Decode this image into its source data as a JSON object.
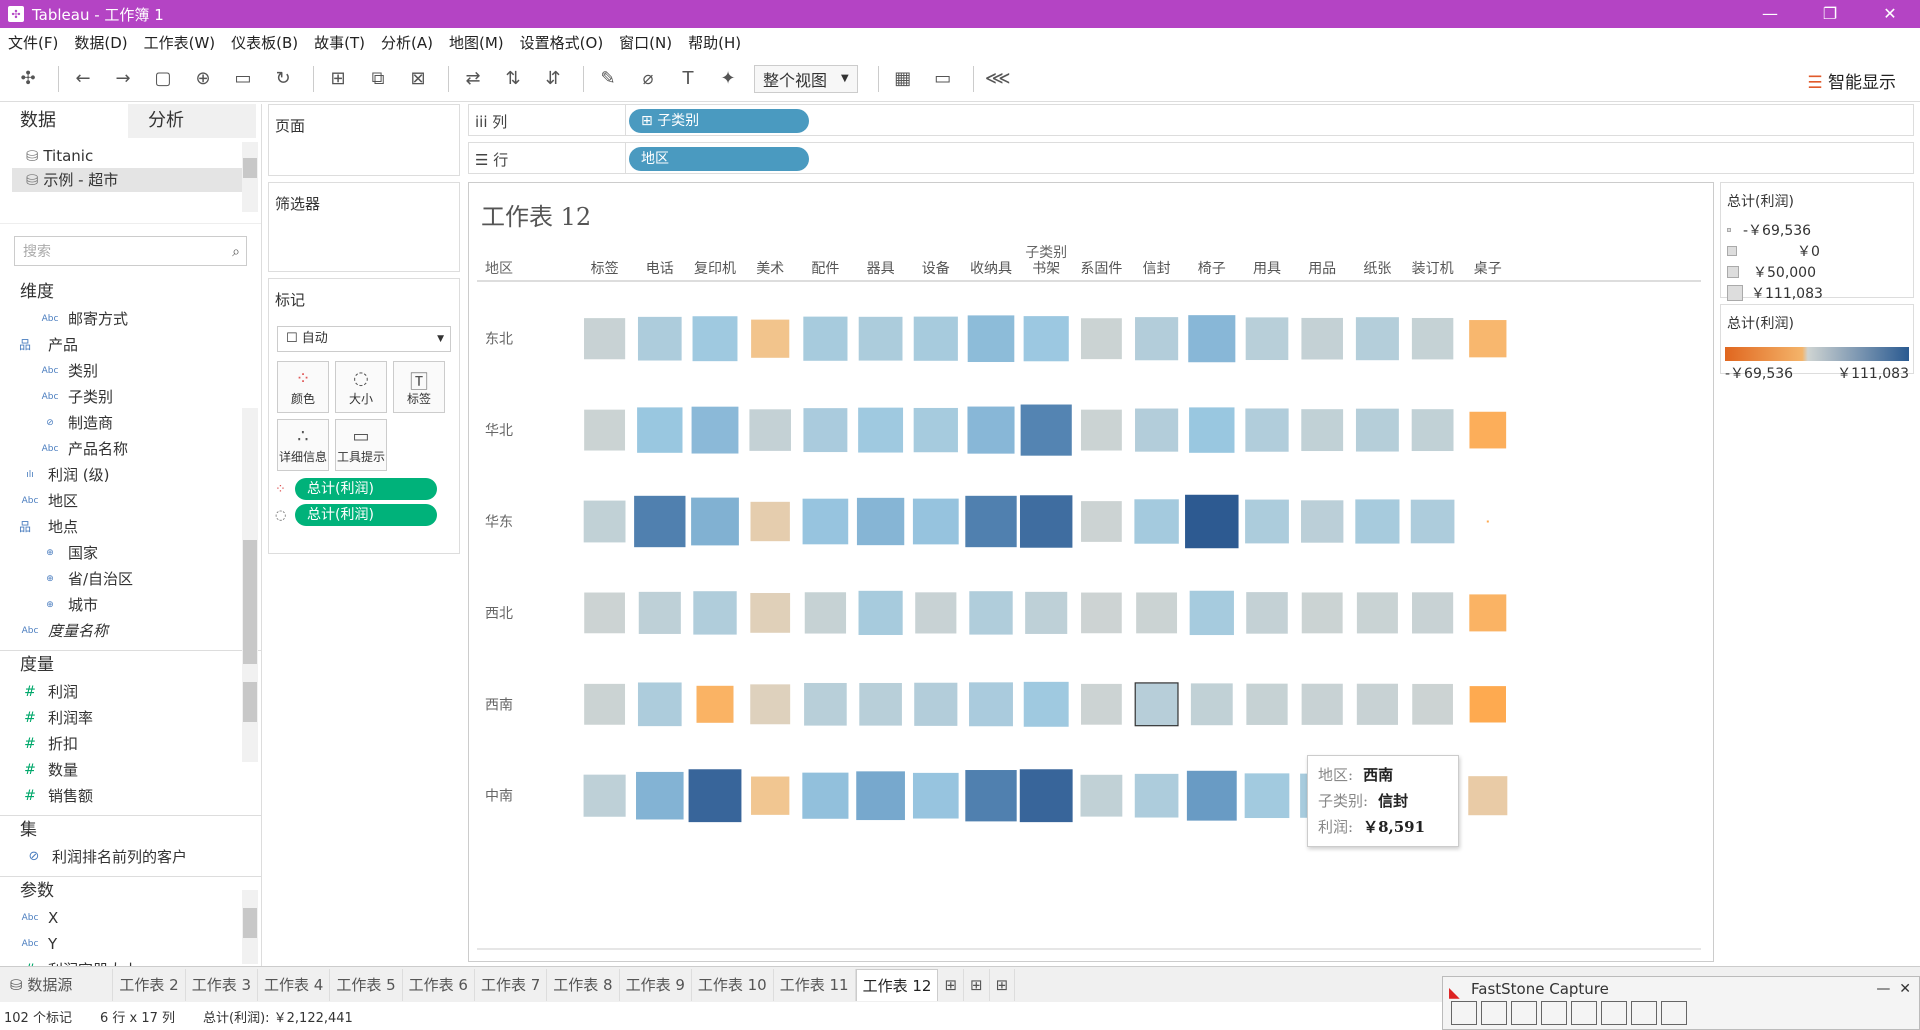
{
  "window": {
    "title": "Tableau - 工作簿 1",
    "controls": [
      "—",
      "❐",
      "✕"
    ]
  },
  "menu": [
    "文件(F)",
    "数据(D)",
    "工作表(W)",
    "仪表板(B)",
    "故事(T)",
    "分析(A)",
    "地图(M)",
    "设置格式(O)",
    "窗口(N)",
    "帮助(H)"
  ],
  "toolbar": {
    "view_label": "整个视图",
    "smart_show": "智能显示"
  },
  "leftpane": {
    "tab_data": "数据",
    "tab_analysis": "分析",
    "datasources": [
      "Titanic",
      "示例 - 超市"
    ],
    "search_placeholder": "搜索",
    "dimensions_title": "维度",
    "dimensions": [
      {
        "label": "邮寄方式",
        "type": "Abc",
        "indent": 1
      },
      {
        "label": "产品",
        "type": "品",
        "indent": 0,
        "group": true
      },
      {
        "label": "类别",
        "type": "Abc",
        "indent": 1
      },
      {
        "label": "子类别",
        "type": "Abc",
        "indent": 1
      },
      {
        "label": "制造商",
        "type": "⊘",
        "indent": 1
      },
      {
        "label": "产品名称",
        "type": "Abc",
        "indent": 1
      },
      {
        "label": "利润 (级)",
        "type": "ılı",
        "indent": 0
      },
      {
        "label": "地区",
        "type": "Abc",
        "indent": 0
      },
      {
        "label": "地点",
        "type": "品",
        "indent": 0,
        "group": true
      },
      {
        "label": "国家",
        "type": "⊕",
        "indent": 1
      },
      {
        "label": "省/自治区",
        "type": "⊕",
        "indent": 1
      },
      {
        "label": "城市",
        "type": "⊕",
        "indent": 1
      },
      {
        "label": "度量名称",
        "type": "Abc",
        "indent": 0,
        "italic": true
      }
    ],
    "measures_title": "度量",
    "measures": [
      "利润",
      "利润率",
      "折扣",
      "数量",
      "销售额"
    ],
    "sets_title": "集",
    "sets": [
      "利润排名前列的客户"
    ],
    "params_title": "参数",
    "params": [
      {
        "label": "X",
        "type": "Abc"
      },
      {
        "label": "Y",
        "type": "Abc"
      },
      {
        "label": "利润容器大小",
        "type": "#"
      }
    ]
  },
  "shelves": {
    "pages": "页面",
    "filters": "筛选器",
    "marks": "标记",
    "marks_type": "自动",
    "mark_buttons": [
      "颜色",
      "大小",
      "标签",
      "详细信息",
      "工具提示"
    ],
    "mark_pills": [
      "总计(利润)",
      "总计(利润)"
    ],
    "columns_label": "列",
    "rows_label": "行",
    "columns_pill": "子类别",
    "rows_pill": "地区"
  },
  "viz": {
    "title": "工作表 12",
    "header_group": "子类别",
    "row_header": "地区"
  },
  "chart_data": {
    "type": "heatmap",
    "title": "工作表 12",
    "xlabel": "子类别",
    "ylabel": "地区",
    "measure": "总计(利润)",
    "columns": [
      "标签",
      "电话",
      "复印机",
      "美术",
      "配件",
      "器具",
      "设备",
      "收纳具",
      "书架",
      "系固件",
      "信封",
      "椅子",
      "用具",
      "用品",
      "纸张",
      "装订机",
      "桌子"
    ],
    "rows": [
      "东北",
      "华北",
      "华东",
      "西北",
      "西南",
      "中南"
    ],
    "values": [
      [
        2500,
        12000,
        17000,
        -8000,
        14000,
        12500,
        14000,
        24000,
        18000,
        1500,
        10000,
        26000,
        8000,
        4000,
        9500,
        3500,
        -11000
      ],
      [
        1500,
        19000,
        25000,
        4000,
        13000,
        17000,
        14500,
        26000,
        44000,
        1500,
        10000,
        19000,
        10500,
        5000,
        9000,
        5000,
        -13000
      ],
      [
        5000,
        45000,
        29000,
        -4000,
        20000,
        27000,
        20500,
        45000,
        50000,
        1000,
        15000,
        55000,
        12500,
        7000,
        14000,
        12000,
        -69536
      ],
      [
        1000,
        6000,
        11000,
        -2500,
        3000,
        14000,
        2500,
        11000,
        6000,
        800,
        1500,
        14500,
        4000,
        1500,
        2000,
        2500,
        -12000
      ],
      [
        1500,
        12000,
        -12000,
        -2000,
        8000,
        8000,
        10000,
        13000,
        17000,
        1200,
        8591,
        5000,
        3000,
        2500,
        2500,
        900,
        -14000
      ],
      [
        6000,
        28000,
        52000,
        -7500,
        22000,
        33000,
        20000,
        45000,
        52000,
        5000,
        12000,
        38000,
        16000,
        14000,
        14000,
        11000,
        -5000
      ]
    ],
    "size_range": [
      -69536,
      111083
    ],
    "color_range": [
      -69536,
      111083
    ]
  },
  "tooltip": {
    "region_label": "地区:",
    "region_value": "西南",
    "subcat_label": "子类别:",
    "subcat_value": "信封",
    "profit_label": "利润:",
    "profit_value": "￥8,591"
  },
  "legends": {
    "size_title": "总计(利润)",
    "size_items": [
      "-￥69,536",
      "￥0",
      "￥50,000",
      "￥111,083"
    ],
    "color_title": "总计(利润)",
    "color_min": "-￥69,536",
    "color_max": "￥111,083"
  },
  "sheettabs": {
    "datasource": "数据源",
    "sheets": [
      "工作表 2",
      "工作表 3",
      "工作表 4",
      "工作表 5",
      "工作表 6",
      "工作表 7",
      "工作表 8",
      "工作表 9",
      "工作表 10",
      "工作表 11",
      "工作表 12"
    ],
    "active": "工作表 12"
  },
  "status": {
    "marks": "102 个标记",
    "dims": "6 行 x 17 列",
    "sum": "总计(利润): ￥2,122,441"
  },
  "faststone": {
    "title": "FastStone Capture"
  }
}
